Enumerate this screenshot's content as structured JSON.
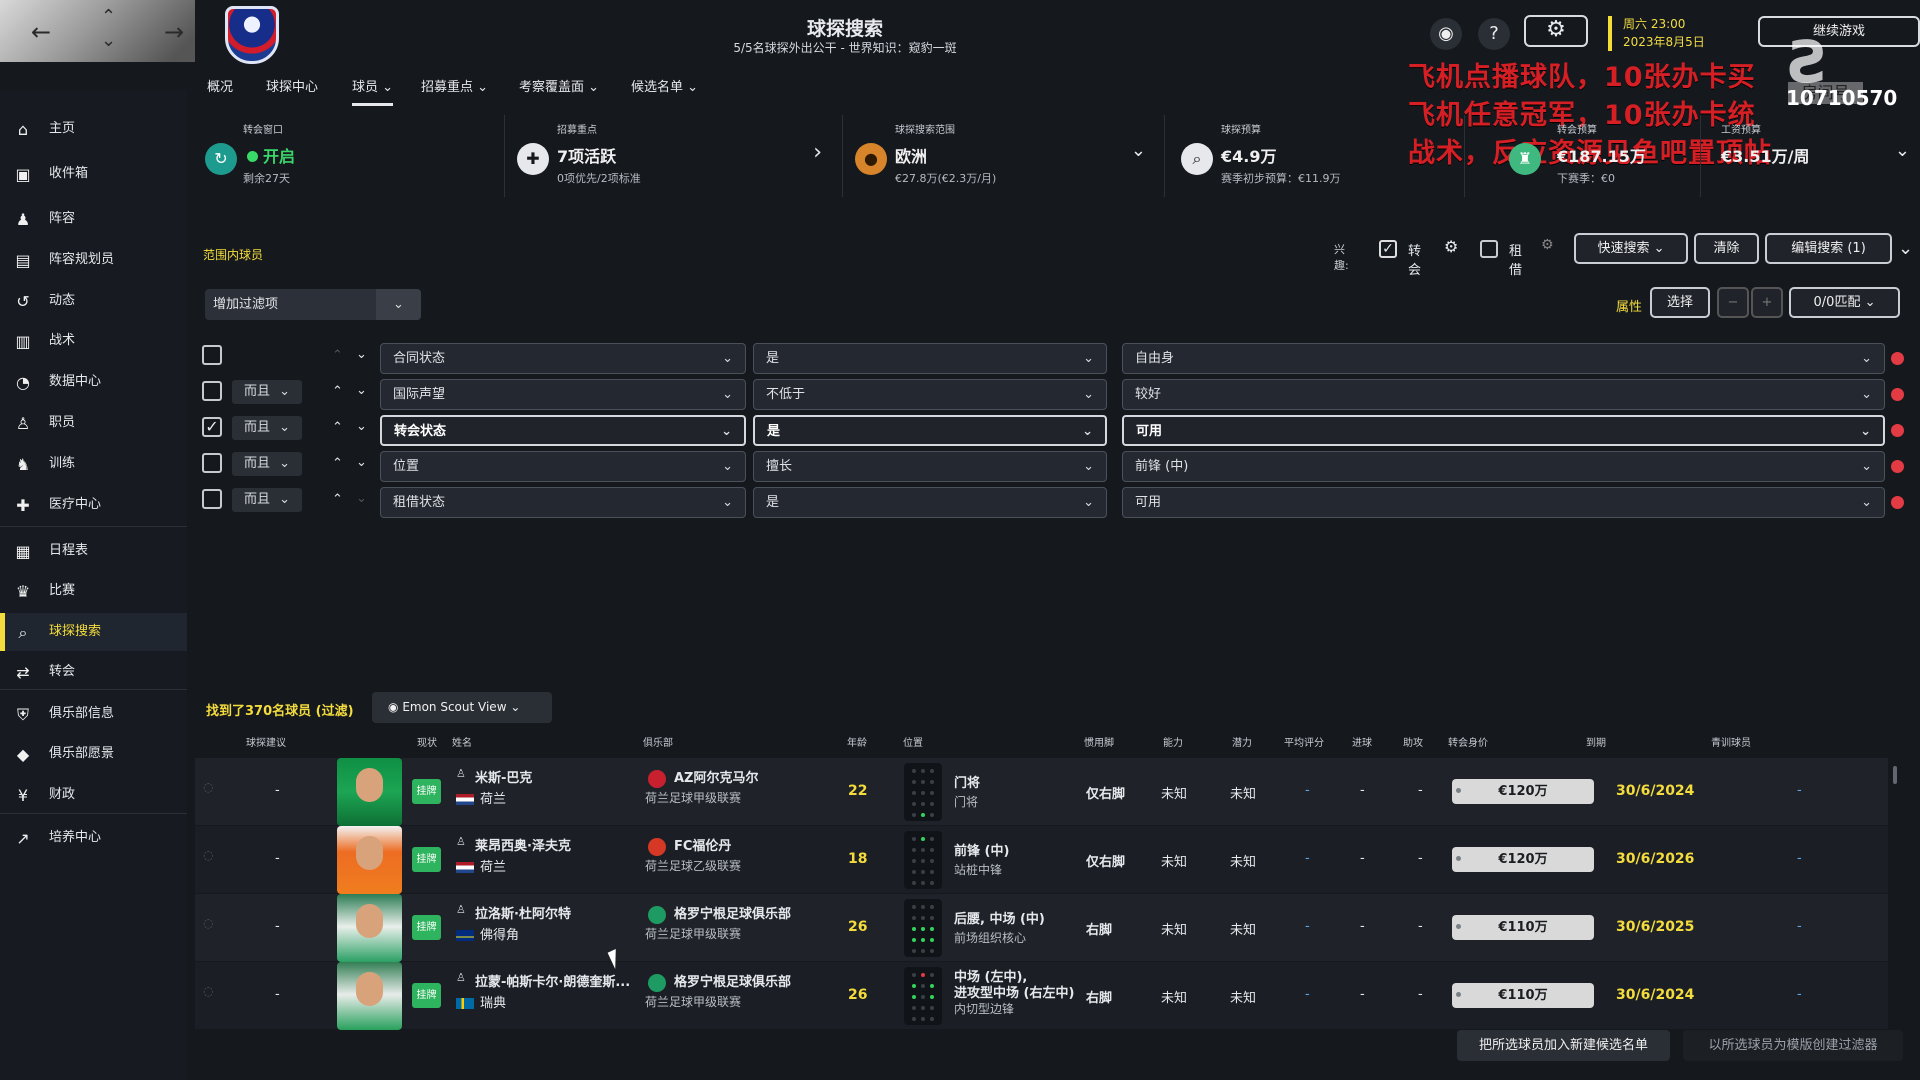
{
  "header": {
    "title": "球探搜索",
    "subtitle": "5/5名球探外出公干 - 世界知识：窥豹一斑",
    "date_line1": "周六 23:00",
    "date_line2": "2023年8月5日",
    "continue_label": "继续游戏",
    "room_label": "房间号",
    "room_number": "10710570"
  },
  "overlay": {
    "line1": "飞机点播球队，10张办卡买",
    "line2": "飞机任意冠军，10张办卡统",
    "line3": "战术，反应资源见鱼吧置顶帖"
  },
  "menu": [
    "概况",
    "球探中心",
    "球员",
    "招募重点",
    "考察覆盖面",
    "候选名单"
  ],
  "sidebar": [
    {
      "label": "主页",
      "icon": "home-icon"
    },
    {
      "label": "收件箱",
      "icon": "inbox-icon"
    },
    {
      "label": "阵容",
      "icon": "squad-icon"
    },
    {
      "label": "阵容规划员",
      "icon": "planner-icon"
    },
    {
      "label": "动态",
      "icon": "dynamics-icon"
    },
    {
      "label": "战术",
      "icon": "tactics-icon"
    },
    {
      "label": "数据中心",
      "icon": "data-icon"
    },
    {
      "label": "职员",
      "icon": "staff-icon"
    },
    {
      "label": "训练",
      "icon": "training-icon"
    },
    {
      "label": "医疗中心",
      "icon": "medical-icon"
    },
    {
      "label": "日程表",
      "icon": "calendar-icon"
    },
    {
      "label": "比赛",
      "icon": "trophy-icon"
    },
    {
      "label": "球探搜索",
      "icon": "search-icon"
    },
    {
      "label": "转会",
      "icon": "transfer-icon"
    },
    {
      "label": "俱乐部信息",
      "icon": "shield-icon"
    },
    {
      "label": "俱乐部愿景",
      "icon": "vision-icon"
    },
    {
      "label": "财政",
      "icon": "finance-icon"
    },
    {
      "label": "培养中心",
      "icon": "development-icon"
    }
  ],
  "summary": {
    "window_label": "转会窗口",
    "window_value": "开启",
    "window_sub": "剩余27天",
    "focus_label": "招募重点",
    "focus_value": "7项活跃",
    "focus_sub": "0项优先/2项标准",
    "range_label": "球探搜索范围",
    "range_value": "欧洲",
    "range_sub": "€27.8万(€2.3万/月)",
    "budget_label": "球探预算",
    "budget_value": "€4.9万",
    "budget_sub": "赛季初步预算：€11.9万",
    "transfer_label": "转会预算",
    "transfer_value": "€187.15万",
    "transfer_sub": "下赛季：€0",
    "wage_label": "工资预算",
    "wage_value": "€3.51万/周"
  },
  "filters": {
    "range_title": "范围内球员",
    "interest_label": "兴趣:",
    "transfer_label": "转会",
    "loan_label": "租借",
    "quick_search": "快速搜索",
    "clear": "清除",
    "edit_search": "编辑搜索 (1)",
    "add_filter": "增加过滤项",
    "attributes": "属性",
    "select": "选择",
    "match": "0/0匹配",
    "rules": [
      {
        "checked": false,
        "logic": "",
        "field": "合同状态",
        "op": "是",
        "value": "自由身"
      },
      {
        "checked": false,
        "logic": "而且",
        "field": "国际声望",
        "op": "不低于",
        "value": "较好"
      },
      {
        "checked": true,
        "logic": "而且",
        "field": "转会状态",
        "op": "是",
        "value": "可用"
      },
      {
        "checked": false,
        "logic": "而且",
        "field": "位置",
        "op": "擅长",
        "value": "前锋 (中)"
      },
      {
        "checked": false,
        "logic": "而且",
        "field": "租借状态",
        "op": "是",
        "value": "可用"
      }
    ]
  },
  "results": {
    "title": "找到了370名球员 (过滤)",
    "view": "Emon Scout View",
    "headers": [
      "球探建议",
      "现状",
      "姓名",
      "俱乐部",
      "年龄",
      "位置",
      "惯用脚",
      "能力",
      "潜力",
      "平均评分",
      "进球",
      "助攻",
      "转会身价",
      "到期",
      "青训球员"
    ],
    "players": [
      {
        "suggest": "-",
        "status": "挂牌",
        "name": "米斯-巴克",
        "nation": "荷兰",
        "club": "AZ阿尔克马尔",
        "league": "荷兰足球甲级联赛",
        "age": "22",
        "position": "门将",
        "role": "门将",
        "foot": "仅右脚",
        "ability": "未知",
        "potential": "未知",
        "rating": "-",
        "goals": "-",
        "assists": "-",
        "value": "€120万",
        "expires": "30/6/2024",
        "youth": "-"
      },
      {
        "suggest": "-",
        "status": "挂牌",
        "name": "莱昂西奥·泽夫克",
        "nation": "荷兰",
        "club": "FC福伦丹",
        "league": "荷兰足球乙级联赛",
        "age": "18",
        "position": "前锋 (中)",
        "role": "站桩中锋",
        "foot": "仅右脚",
        "ability": "未知",
        "potential": "未知",
        "rating": "-",
        "goals": "-",
        "assists": "-",
        "value": "€120万",
        "expires": "30/6/2026",
        "youth": "-"
      },
      {
        "suggest": "-",
        "status": "挂牌",
        "name": "拉洛斯·杜阿尔特",
        "nation": "佛得角",
        "club": "格罗宁根足球俱乐部",
        "league": "荷兰足球甲级联赛",
        "age": "26",
        "position": "后腰, 中场 (中)",
        "role": "前场组织核心",
        "foot": "右脚",
        "ability": "未知",
        "potential": "未知",
        "rating": "-",
        "goals": "-",
        "assists": "-",
        "value": "€110万",
        "expires": "30/6/2025",
        "youth": "-"
      },
      {
        "suggest": "-",
        "status": "挂牌",
        "name": "拉蒙-帕斯卡尔·朗德奎斯...",
        "nation": "瑞典",
        "club": "格罗宁根足球俱乐部",
        "league": "荷兰足球甲级联赛",
        "age": "26",
        "position": "中场 (左中),",
        "position2": "进攻型中场 (右左中)",
        "role": "内切型边锋",
        "foot": "右脚",
        "ability": "未知",
        "potential": "未知",
        "rating": "-",
        "goals": "-",
        "assists": "-",
        "value": "€110万",
        "expires": "30/6/2024",
        "youth": "-"
      }
    ],
    "bottom_add": "把所选球员加入新建候选名单",
    "bottom_template": "以所选球员为模版创建过滤器"
  }
}
